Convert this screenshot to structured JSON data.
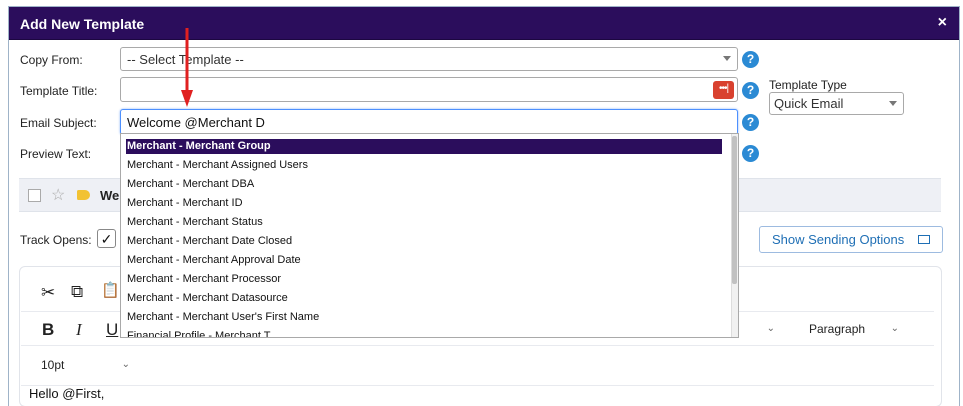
{
  "dialog": {
    "title": "Add New Template",
    "close": "×"
  },
  "form": {
    "copy_from_label": "Copy From:",
    "copy_from_value": "-- Select Template --",
    "template_title_label": "Template Title:",
    "template_title_value": "",
    "email_subject_label": "Email Subject:",
    "email_subject_value": "Welcome @Merchant D",
    "preview_text_label": "Preview Text:",
    "template_type_label": "Template Type",
    "template_type_value": "Quick Email",
    "help_glyph": "?",
    "password_icon_glyph": "•••|"
  },
  "dropdown": {
    "items": [
      "Merchant - Merchant Group",
      "Merchant - Merchant Assigned Users",
      "Merchant - Merchant DBA",
      "Merchant - Merchant ID",
      "Merchant - Merchant Status",
      "Merchant - Merchant Date Closed",
      "Merchant - Merchant Approval Date",
      "Merchant - Merchant Processor",
      "Merchant - Merchant Datasource",
      "Merchant - Merchant User's First Name",
      "Financial Profile - Merchant T..."
    ],
    "selected_index": 0
  },
  "preview_bar": {
    "subject_snippet": "We",
    "star": "☆"
  },
  "tracking": {
    "track_opens_label": "Track Opens:",
    "check_glyph": "✓",
    "show_sending_options": "Show Sending Options"
  },
  "editor": {
    "cut_glyph": "✂",
    "copy_glyph": "⧉",
    "paste_glyph": "📋",
    "bold": "B",
    "italic": "I",
    "underline": "U",
    "format_value": "Paragraph",
    "font_size_value": "10pt",
    "chevron": "⌄",
    "body_text": "Hello @First,"
  },
  "colors": {
    "titlebar": "#2b0d5c",
    "help": "#2b8ad4",
    "arrow": "#e02020",
    "selected_item": "#2b0d5c"
  }
}
